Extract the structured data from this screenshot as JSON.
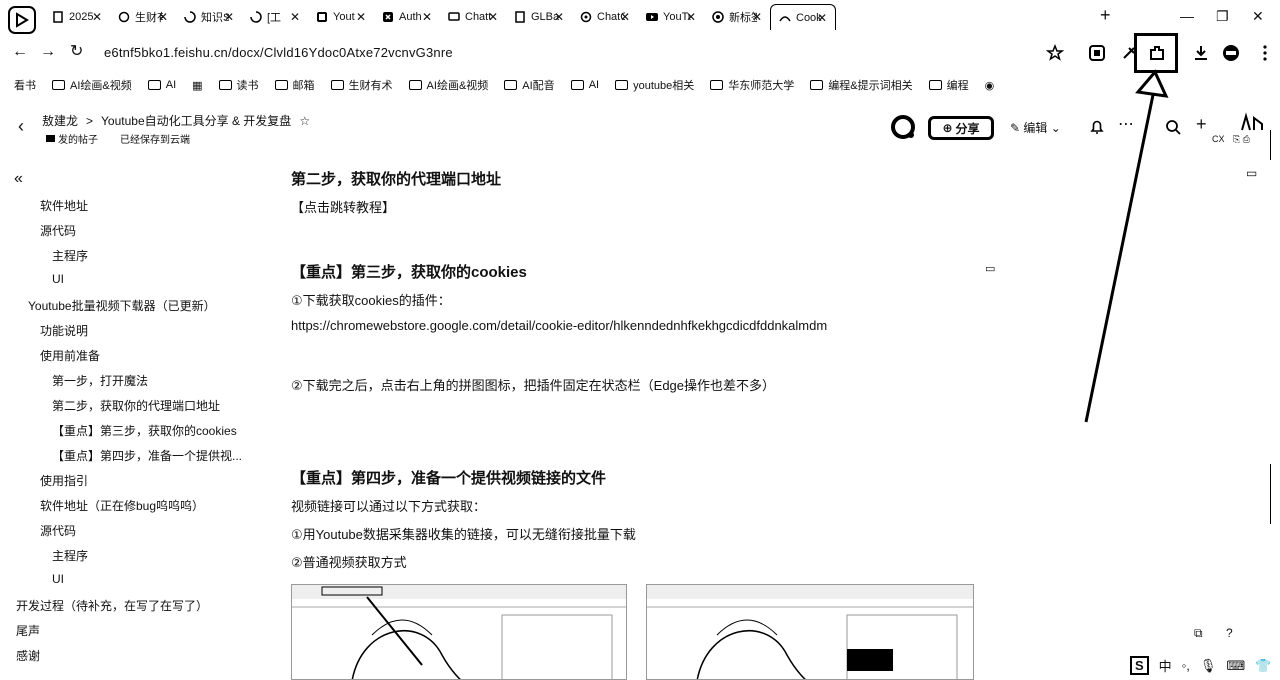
{
  "browser": {
    "tabs": [
      {
        "title": "2025",
        "icon": "doc-icon"
      },
      {
        "title": "生财有",
        "icon": "refresh-icon"
      },
      {
        "title": "知识S",
        "icon": "loading-icon"
      },
      {
        "title": "[工",
        "icon": "loading-icon"
      },
      {
        "title": "Yout",
        "icon": "page-icon"
      },
      {
        "title": "Auth",
        "icon": "auth-icon"
      },
      {
        "title": "Chatt",
        "icon": "chat-icon"
      },
      {
        "title": "GLBai",
        "icon": "doc-icon"
      },
      {
        "title": "ChatC",
        "icon": "openai-icon"
      },
      {
        "title": "YouTu",
        "icon": "youtube-icon"
      },
      {
        "title": "新标签",
        "icon": "chrome-icon"
      },
      {
        "title": "Cook",
        "icon": "cookie-icon"
      }
    ],
    "new_tab": "+",
    "url": "e6tnf5bko1.feishu.cn/docx/Clvld16Ydoc0Atxe72vcnvG3nre",
    "bookmarks": [
      {
        "label": "看书",
        "type": "text"
      },
      {
        "label": "AI绘画&视频",
        "type": "folder"
      },
      {
        "label": "AI",
        "type": "folder"
      },
      {
        "label": "读书",
        "type": "folder"
      },
      {
        "label": "邮箱",
        "type": "folder"
      },
      {
        "label": "生财有术",
        "type": "folder"
      },
      {
        "label": "AI绘画&视频",
        "type": "folder"
      },
      {
        "label": "AI配音",
        "type": "folder"
      },
      {
        "label": "AI",
        "type": "folder"
      },
      {
        "label": "youtube相关",
        "type": "folder"
      },
      {
        "label": "华东师范大学",
        "type": "folder"
      },
      {
        "label": "编程&提示词相关",
        "type": "folder"
      },
      {
        "label": "编程",
        "type": "folder"
      }
    ]
  },
  "doc": {
    "breadcrumb_author": "敖建龙",
    "breadcrumb_sep": ">",
    "title": "Youtube自动化工具分享 & 开发复盘",
    "sub_posts": "发的帖子",
    "sub_saved": "已经保存到云端",
    "share_label": "分享",
    "edit_label": "编辑"
  },
  "sidebar": {
    "collapse": "«",
    "items": [
      {
        "label": "软件地址",
        "level": 2
      },
      {
        "label": "源代码",
        "level": 2
      },
      {
        "label": "主程序",
        "level": 3
      },
      {
        "label": "UI",
        "level": 3
      },
      {
        "label": "Youtube批量视频下载器（已更新）",
        "level": 1
      },
      {
        "label": "功能说明",
        "level": 2
      },
      {
        "label": "使用前准备",
        "level": 2
      },
      {
        "label": "第一步，打开魔法",
        "level": 3
      },
      {
        "label": "第二步，获取你的代理端口地址",
        "level": 3
      },
      {
        "label": "【重点】第三步，获取你的cookies",
        "level": 3
      },
      {
        "label": "【重点】第四步，准备一个提供视...",
        "level": 3
      },
      {
        "label": "使用指引",
        "level": 2
      },
      {
        "label": "软件地址（正在修bug呜呜呜）",
        "level": 2
      },
      {
        "label": "源代码",
        "level": 2
      },
      {
        "label": "主程序",
        "level": 3
      },
      {
        "label": "UI",
        "level": 3
      },
      {
        "label": "开发过程（待补充，在写了在写了）",
        "level": 0
      },
      {
        "label": "尾声",
        "level": 0
      },
      {
        "label": "感谢",
        "level": 0
      }
    ]
  },
  "content": {
    "step2_heading": "第二步，获取你的代理端口地址",
    "step2_link": "【点击跳转教程】",
    "step3_heading": "【重点】第三步，获取你的cookies",
    "step3_p1": "①下载获取cookies的插件：",
    "step3_url": "https://chromewebstore.google.com/detail/cookie-editor/hlkenndednhfkekhgcdicdfddnkalmdm",
    "step3_p2": "②下载完之后，点击右上角的拼图图标，把插件固定在状态栏（Edge操作也差不多）",
    "step4_heading": "【重点】第四步，准备一个提供视频链接的文件",
    "step4_p1": "视频链接可以通过以下方式获取：",
    "step4_p2": "①用Youtube数据采集器收集的链接，可以无缝衔接批量下载",
    "step4_p3": "②普通视频获取方式"
  },
  "right_rail": {
    "cx_label": "CX"
  },
  "ime": {
    "lang": "中"
  }
}
